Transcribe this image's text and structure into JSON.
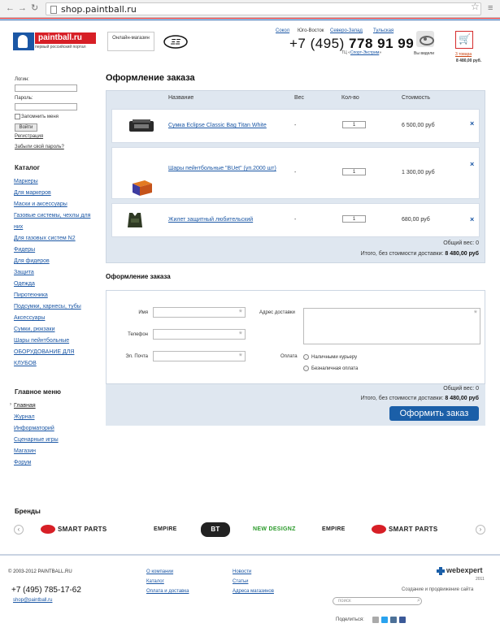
{
  "browser": {
    "url": "shop.paintball.ru"
  },
  "header": {
    "logo_text": "paintball.ru",
    "logo_tagline": "первый российский портал",
    "shop_box": "Онлайн-магазин",
    "metro": [
      "Сокол",
      "Юго-Восток",
      "Северо-Запад",
      "Тульская"
    ],
    "phone_prefix": "+7 (495)",
    "phone_number": "778 91 99",
    "phone_note_prefix": "ТЦ «",
    "phone_note_link": "Спорт-Экстрим",
    "phone_note_suffix": "»",
    "seen_label": "Вы видели",
    "cart_count": "3 товара",
    "cart_sum": "8 480,00 руб."
  },
  "sidebar": {
    "login_label": "Логин:",
    "password_label": "Пароль:",
    "remember_label": "Запомнить меня",
    "login_button": "Войти",
    "register_link": "Регистрация",
    "forgot_link": "Забыли свой пароль?",
    "catalog_heading": "Каталог",
    "catalog": [
      "Маркеры",
      "Для маркеров",
      "Маски и аксессуары",
      "Газовые системы, чехлы для",
      "них",
      "Для газовых систем N2",
      "Фидеры",
      "Для фидеров",
      "Защита",
      "Одежда",
      "Пиротехника",
      "Подсумки, харнесы, тубы",
      "Аксессуары",
      "Сумки, рюкзаки",
      "Шары пейнтбольные",
      "ОБОРУДОВАНИЕ ДЛЯ",
      "КЛУБОВ"
    ],
    "main_menu_heading": "Главное меню",
    "main_menu": [
      "Главная",
      "Журнал",
      "Информаторий",
      "Сценарные игры",
      "Магазин",
      "Форум"
    ]
  },
  "order": {
    "title": "Оформление заказа",
    "columns": {
      "name": "Название",
      "weight": "Вес",
      "qty": "Кол-во",
      "cost": "Стоимость"
    },
    "items": [
      {
        "name": "Сумка Eclipse Classic Bag Titan White",
        "weight": "-",
        "qty": "1",
        "cost": "6 500,00 руб",
        "thumb_icon": "bag-icon",
        "remove_icon": "×"
      },
      {
        "name": "Шары пейнтбольные \"BUet\" (уп.2000 шт)",
        "weight": "-",
        "qty": "1",
        "cost": "1 300,00 руб",
        "thumb_icon": "box-icon",
        "remove_icon": "×"
      },
      {
        "name": "Жилет защитный любительский",
        "weight": "-",
        "qty": "1",
        "cost": "680,00 руб",
        "thumb_icon": "vest-icon",
        "remove_icon": "×"
      }
    ],
    "total_weight_label": "Общий вес: 0",
    "total_label": "Итого, без стоимости доставки:",
    "total_value": "8 480,00 руб"
  },
  "checkout": {
    "title": "Оформление заказа",
    "name_label": "Имя",
    "phone_label": "Телефон",
    "email_label": "Эл. Почта",
    "address_label": "Адрес доставки",
    "payment_label": "Оплата",
    "payment_options": [
      "Наличными курьеру",
      "Безналичная оплата"
    ],
    "total_weight_label": "Общий вес: 0",
    "total_label": "Итого, без стоимости доставки:",
    "total_value": "8 480,00 руб",
    "submit": "Оформить заказ"
  },
  "brands": {
    "heading": "Бренды",
    "logos": [
      "SMART PARTS",
      "EMPIRE",
      "BT",
      "NEW DESIGNZ",
      "EMPIRE",
      "SMART PARTS"
    ]
  },
  "footer": {
    "copyright": "© 2003-2012 PAINTBALL.RU",
    "phone": "+7 (495) 785-17-62",
    "email": "shop@paintball.ru",
    "col1": [
      "О компании",
      "Каталог",
      "Оплата и доставка"
    ],
    "col2": [
      "Новости",
      "Статьи",
      "Адреса магазинов"
    ],
    "webexpert": "webexpert",
    "webexpert_year": "2011",
    "webexpert_note": "Создание и продвижение сайта",
    "search_placeholder": "поиск",
    "share_label": "Поделиться:"
  },
  "colors": {
    "accent": "#1b5fa8",
    "brand_red": "#d71f26",
    "panel": "#dfe7f0"
  }
}
